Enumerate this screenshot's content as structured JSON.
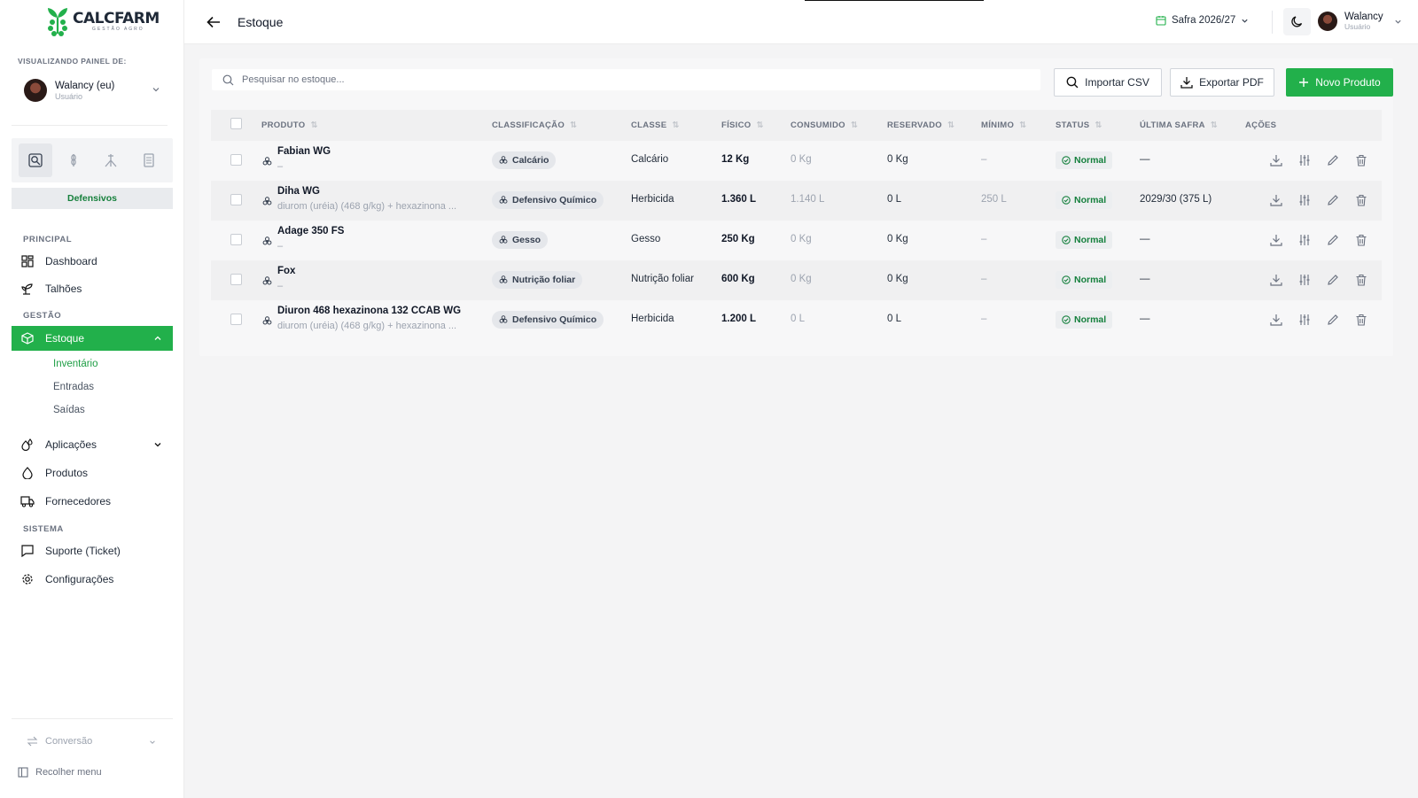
{
  "brand": {
    "name": "CALCFARM",
    "sub": "GESTÃO AGRO"
  },
  "sidebar": {
    "viewing_label": "VISUALIZANDO PAINEL DE:",
    "user": {
      "name": "Walancy (eu)",
      "role": "Usuário"
    },
    "modules": [
      "lab-icon",
      "grain-icon",
      "tripod-icon",
      "clipboard-icon"
    ],
    "module_label": "Defensivos",
    "sections": {
      "principal": "PRINCIPAL",
      "gestao": "GESTÃO",
      "sistema": "SISTEMA"
    },
    "items": {
      "dashboard": "Dashboard",
      "talhoes": "Talhões",
      "estoque": "Estoque",
      "aplicacoes": "Aplicações",
      "produtos": "Produtos",
      "fornecedores": "Fornecedores",
      "suporte": "Suporte (Ticket)",
      "configuracoes": "Configurações"
    },
    "estoque_sub": [
      "Inventário",
      "Entradas",
      "Saídas"
    ],
    "conversao": "Conversão",
    "recolher": "Recolher menu"
  },
  "header": {
    "title": "Estoque",
    "safra": "Safra 2026/27",
    "user": {
      "name": "Walancy",
      "role": "Usuário"
    }
  },
  "toolbar": {
    "search_placeholder": "Pesquisar no estoque...",
    "import": "Importar CSV",
    "export": "Exportar PDF",
    "new": "Novo Produto"
  },
  "table": {
    "columns": {
      "produto": "PRODUTO",
      "classificacao": "CLASSIFICAÇÃO",
      "classe": "CLASSE",
      "fisico": "FÍSICO",
      "consumido": "CONSUMIDO",
      "reservado": "RESERVADO",
      "minimo": "MÍNIMO",
      "status": "STATUS",
      "ultima_safra": "ÚLTIMA SAFRA",
      "acoes": "AÇÕES"
    },
    "rows": [
      {
        "name": "Fabian WG",
        "sub": "–",
        "classificacao": "Calcário",
        "classe": "Calcário",
        "fisico": "12 Kg",
        "consumido": "0 Kg",
        "reservado": "0 Kg",
        "minimo": "–",
        "status": "Normal",
        "ultima_safra": "—"
      },
      {
        "name": "Diha WG",
        "sub": "diurom (uréia) (468 g/kg) + hexazinona ...",
        "classificacao": "Defensivo Químico",
        "classe": "Herbicida",
        "fisico": "1.360 L",
        "consumido": "1.140 L",
        "reservado": "0 L",
        "minimo": "250 L",
        "status": "Normal",
        "ultima_safra": "2029/30 (375 L)"
      },
      {
        "name": "Adage 350 FS",
        "sub": "–",
        "classificacao": "Gesso",
        "classe": "Gesso",
        "fisico": "250 Kg",
        "consumido": "0 Kg",
        "reservado": "0 Kg",
        "minimo": "–",
        "status": "Normal",
        "ultima_safra": "—"
      },
      {
        "name": "Fox",
        "sub": "–",
        "classificacao": "Nutrição foliar",
        "classe": "Nutrição foliar",
        "fisico": "600 Kg",
        "consumido": "0 Kg",
        "reservado": "0 Kg",
        "minimo": "–",
        "status": "Normal",
        "ultima_safra": "—"
      },
      {
        "name": "Diuron 468 hexazinona 132 CCAB WG",
        "sub": "diurom (uréia) (468 g/kg) + hexazinona ...",
        "classificacao": "Defensivo Químico",
        "classe": "Herbicida",
        "fisico": "1.200 L",
        "consumido": "0 L",
        "reservado": "0 L",
        "minimo": "–",
        "status": "Normal",
        "ultima_safra": "—"
      }
    ]
  },
  "colors": {
    "brand_green": "#22b04b",
    "status_green": "#15803d"
  }
}
